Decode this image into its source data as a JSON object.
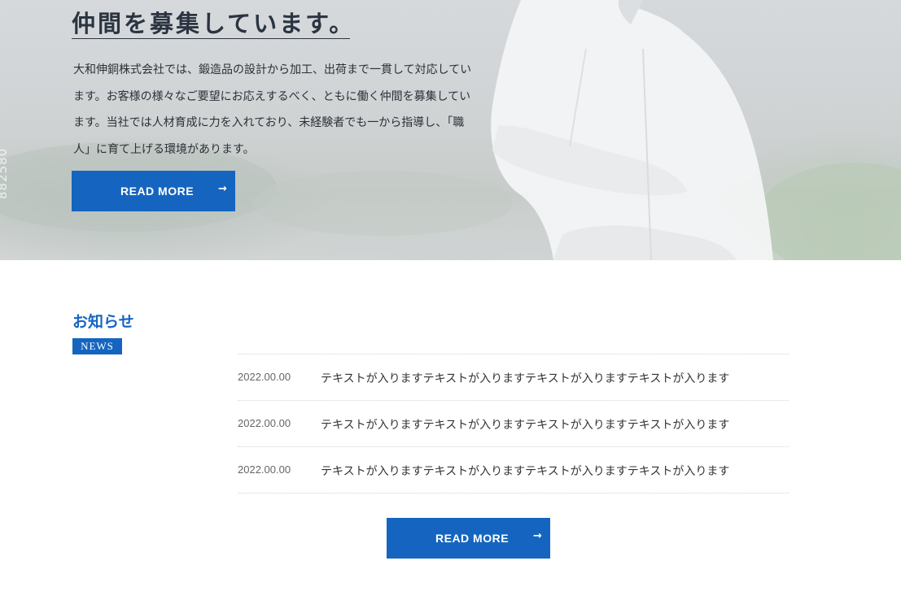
{
  "hero": {
    "title": "仲間を募集しています。",
    "text": "大和伸銅株式会社では、鍛造品の設計から加工、出荷まで一貫して対応しています。お客様の様々なご要望にお応えするべく、ともに働く仲間を募集しています。当社では人材育成に力を入れており、未経験者でも一から指導し、「職人」に育て上げる環境があります。",
    "button_label": "READ MORE",
    "button_arrow": "→",
    "watermark": "882580"
  },
  "news": {
    "title": "お知らせ",
    "badge": "NEWS",
    "items": [
      {
        "date": "2022.00.00",
        "text": "テキストが入りますテキストが入りますテキストが入りますテキストが入ります"
      },
      {
        "date": "2022.00.00",
        "text": "テキストが入りますテキストが入りますテキストが入りますテキストが入ります"
      },
      {
        "date": "2022.00.00",
        "text": "テキストが入りますテキストが入りますテキストが入りますテキストが入ります"
      }
    ],
    "button_label": "READ MORE",
    "button_arrow": "→"
  },
  "colors": {
    "accent": "#1565c0",
    "heading": "#2b3440",
    "divider": "#cfd3d8"
  }
}
